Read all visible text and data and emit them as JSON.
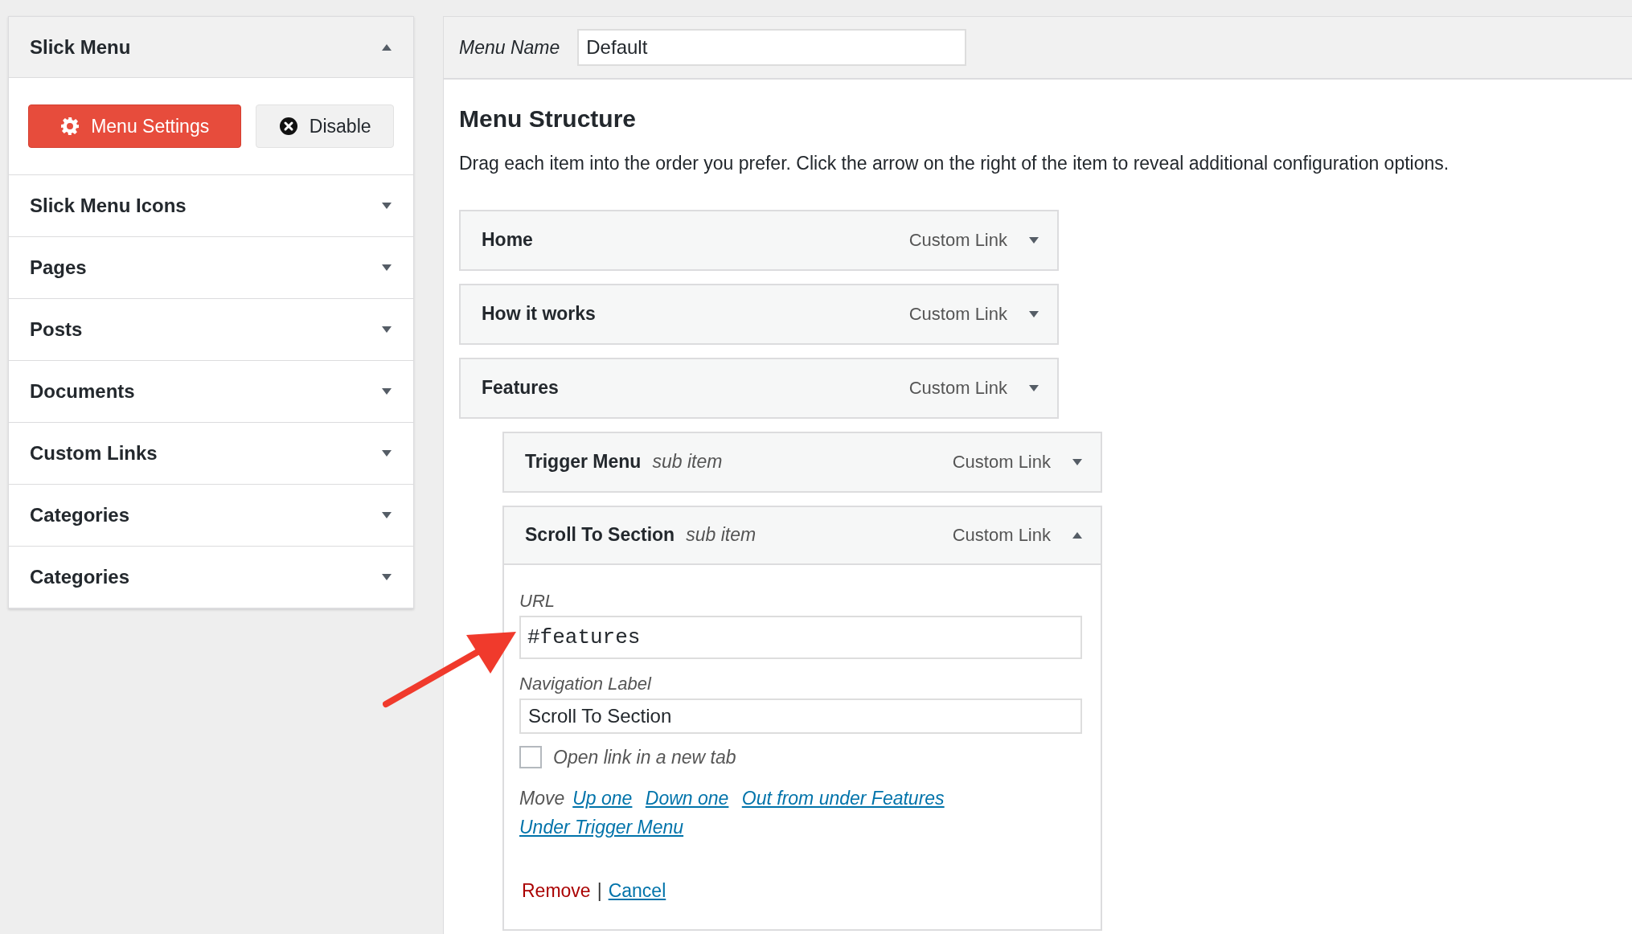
{
  "sidebar": {
    "sections": [
      {
        "title": "Slick Menu",
        "expanded": true,
        "buttons": [
          {
            "label": "Menu Settings",
            "kind": "primary"
          },
          {
            "label": "Disable",
            "kind": "secondary"
          }
        ]
      },
      {
        "title": "Slick Menu Icons",
        "expanded": false
      },
      {
        "title": "Pages",
        "expanded": false
      },
      {
        "title": "Posts",
        "expanded": false
      },
      {
        "title": "Documents",
        "expanded": false
      },
      {
        "title": "Custom Links",
        "expanded": false
      },
      {
        "title": "Categories",
        "expanded": false
      },
      {
        "title": "Categories",
        "expanded": false
      }
    ]
  },
  "menu_name": {
    "label": "Menu Name",
    "value": "Default"
  },
  "menu_structure": {
    "title": "Menu Structure",
    "description": "Drag each item into the order you prefer. Click the arrow on the right of the item to reveal additional configuration options.",
    "items": [
      {
        "title": "Home",
        "type": "Custom Link",
        "expanded": false
      },
      {
        "title": "How it works",
        "type": "Custom Link",
        "expanded": false
      },
      {
        "title": "Features",
        "type": "Custom Link",
        "expanded": false,
        "children": [
          {
            "title": "Trigger Menu",
            "note": "sub item",
            "type": "Custom Link",
            "expanded": false
          },
          {
            "title": "Scroll To Section",
            "note": "sub item",
            "type": "Custom Link",
            "expanded": true,
            "settings": {
              "url_label": "URL",
              "url_value": "#features",
              "nav_label": "Navigation Label",
              "nav_value": "Scroll To Section",
              "new_tab": {
                "label": "Open link in a new tab",
                "checked": false
              },
              "move_label": "Move",
              "move_links": [
                "Up one",
                "Down one",
                "Out from under Features",
                "Under Trigger Menu"
              ],
              "remove": "Remove",
              "separator": "|",
              "cancel": "Cancel"
            }
          }
        ]
      }
    ]
  }
}
